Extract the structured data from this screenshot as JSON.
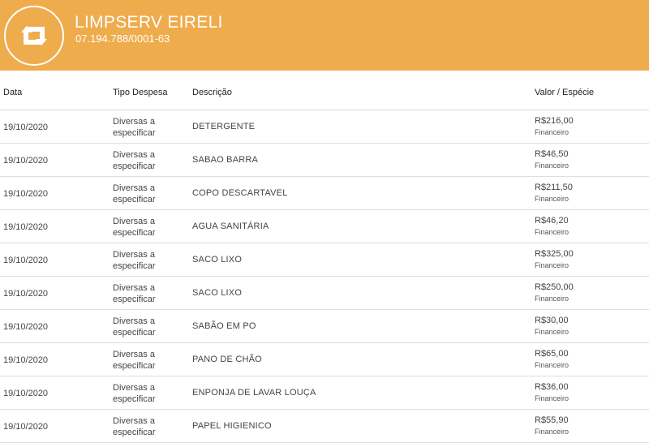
{
  "header": {
    "company_name": "LIMPSERV EIRELI",
    "cnpj": "07.194.788/0001-63",
    "logo_icon": "retweet-arrows-icon"
  },
  "columns": {
    "date": "Data",
    "type": "Tipo Despesa",
    "description": "Descrição",
    "value": "Valor / Espécie"
  },
  "rows": [
    {
      "date": "19/10/2020",
      "type": "Diversas a especificar",
      "description": "DETERGENTE",
      "amount": "R$216,00",
      "species": "Financeiro"
    },
    {
      "date": "19/10/2020",
      "type": "Diversas a especificar",
      "description": "SABAO BARRA",
      "amount": "R$46,50",
      "species": "Financeiro"
    },
    {
      "date": "19/10/2020",
      "type": "Diversas a especificar",
      "description": "COPO DESCARTAVEL",
      "amount": "R$211,50",
      "species": "Financeiro"
    },
    {
      "date": "19/10/2020",
      "type": "Diversas a especificar",
      "description": "AGUA SANITÁRIA",
      "amount": "R$46,20",
      "species": "Financeiro"
    },
    {
      "date": "19/10/2020",
      "type": "Diversas a especificar",
      "description": "SACO LIXO",
      "amount": "R$325,00",
      "species": "Financeiro"
    },
    {
      "date": "19/10/2020",
      "type": "Diversas a especificar",
      "description": "SACO LIXO",
      "amount": "R$250,00",
      "species": "Financeiro"
    },
    {
      "date": "19/10/2020",
      "type": "Diversas a especificar",
      "description": "SABÃO EM PO",
      "amount": "R$30,00",
      "species": "Financeiro"
    },
    {
      "date": "19/10/2020",
      "type": "Diversas a especificar",
      "description": "PANO DE CHÃO",
      "amount": "R$65,00",
      "species": "Financeiro"
    },
    {
      "date": "19/10/2020",
      "type": "Diversas a especificar",
      "description": "ENPONJA DE LAVAR LOUÇA",
      "amount": "R$36,00",
      "species": "Financeiro"
    },
    {
      "date": "19/10/2020",
      "type": "Diversas a especificar",
      "description": "PAPEL HIGIENICO",
      "amount": "R$55,90",
      "species": "Financeiro"
    }
  ]
}
